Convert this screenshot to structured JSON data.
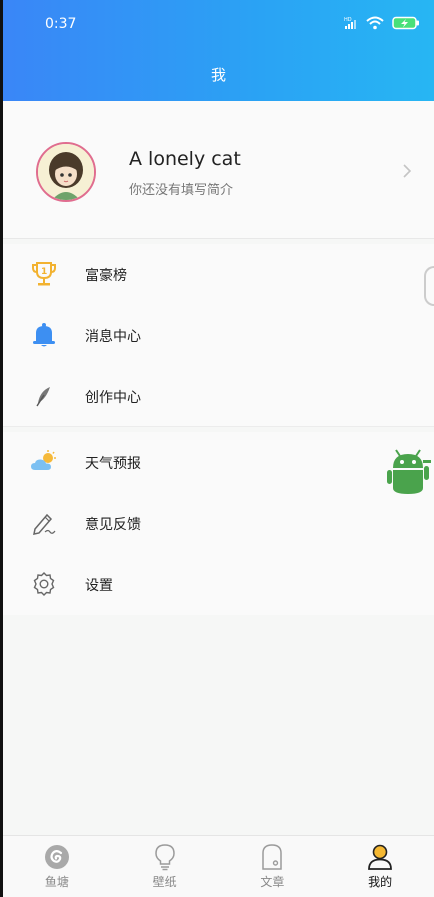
{
  "status_bar": {
    "time": "0:37",
    "signal_label": "HD"
  },
  "header": {
    "title": "我"
  },
  "profile": {
    "name": "A lonely cat",
    "bio": "你还没有填写简介"
  },
  "menu_group_1": [
    {
      "label": "富豪榜",
      "icon": "trophy-icon"
    },
    {
      "label": "消息中心",
      "icon": "bell-icon"
    },
    {
      "label": "创作中心",
      "icon": "feather-icon"
    }
  ],
  "menu_group_2": [
    {
      "label": "天气预报",
      "icon": "weather-icon"
    },
    {
      "label": "意见反馈",
      "icon": "feedback-pen-icon"
    },
    {
      "label": "设置",
      "icon": "gear-icon"
    }
  ],
  "bottom_nav": [
    {
      "label": "鱼塘",
      "icon": "fishpond-icon",
      "active": false
    },
    {
      "label": "壁纸",
      "icon": "bulb-icon",
      "active": false
    },
    {
      "label": "文章",
      "icon": "article-icon",
      "active": false
    },
    {
      "label": "我的",
      "icon": "profile-icon",
      "active": true
    }
  ],
  "colors": {
    "header_gradient_start": "#3a86f7",
    "header_gradient_end": "#27b6f3",
    "trophy": "#f2b230",
    "bell": "#3d8ff2",
    "android": "#4aa34c"
  }
}
